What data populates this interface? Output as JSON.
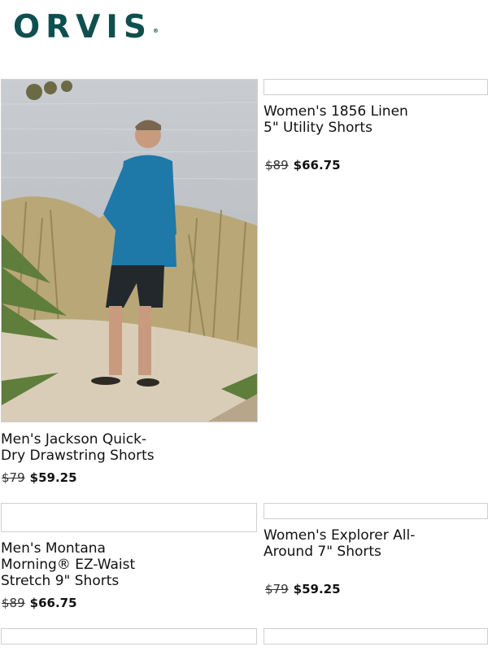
{
  "brand": {
    "logo_text": "ORVIS",
    "registered_mark": "®"
  },
  "products": [
    {
      "name_line1": "Men's Jackson Quick-",
      "name_line2": "Dry Drawstring Shorts",
      "price_old": "$79",
      "price_new": "$59.25"
    },
    {
      "name_line1": "Women's 1856 Linen",
      "name_line2": "5\" Utility Shorts",
      "price_old": "$89",
      "price_new": "$66.75"
    },
    {
      "name_line1": "Men's Montana",
      "name_line2": "Morning® EZ-Waist",
      "name_line3": "Stretch 9\" Shorts",
      "price_old": "$89",
      "price_new": "$66.75"
    },
    {
      "name_line1": "Women's Explorer All-",
      "name_line2": "Around 7\" Shorts",
      "price_old": "$79",
      "price_new": "$59.25"
    }
  ],
  "colors": {
    "brand_teal": "#0f4f4f",
    "border": "#cfcfcf"
  }
}
